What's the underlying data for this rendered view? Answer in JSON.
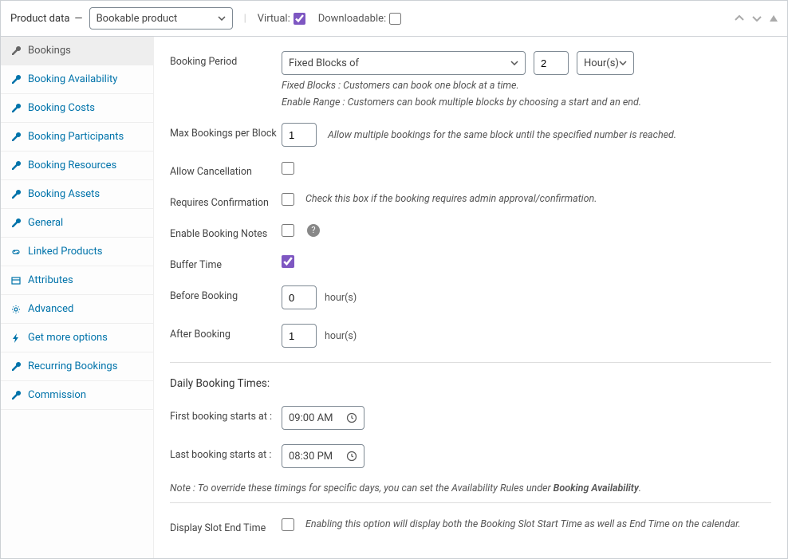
{
  "header": {
    "title": "Product data",
    "product_type": "Bookable product",
    "virtual_label": "Virtual:",
    "virtual_checked": true,
    "downloadable_label": "Downloadable:",
    "downloadable_checked": false
  },
  "sidebar": {
    "items": [
      {
        "label": "Bookings",
        "icon": "wrench",
        "active": true
      },
      {
        "label": "Booking Availability",
        "icon": "wrench",
        "active": false
      },
      {
        "label": "Booking Costs",
        "icon": "wrench",
        "active": false
      },
      {
        "label": "Booking Participants",
        "icon": "wrench",
        "active": false
      },
      {
        "label": "Booking Resources",
        "icon": "wrench",
        "active": false
      },
      {
        "label": "Booking Assets",
        "icon": "wrench",
        "active": false
      },
      {
        "label": "General",
        "icon": "wrench",
        "active": false
      },
      {
        "label": "Linked Products",
        "icon": "link",
        "active": false
      },
      {
        "label": "Attributes",
        "icon": "box",
        "active": false
      },
      {
        "label": "Advanced",
        "icon": "gear",
        "active": false
      },
      {
        "label": "Get more options",
        "icon": "bolt",
        "active": false
      },
      {
        "label": "Recurring Bookings",
        "icon": "wrench",
        "active": false
      },
      {
        "label": "Commission",
        "icon": "wrench",
        "active": false
      }
    ]
  },
  "form": {
    "booking_period": {
      "label": "Booking Period",
      "type_value": "Fixed Blocks of",
      "qty": "2",
      "unit": "Hour(s)",
      "help1": "Fixed Blocks : Customers can book one block at a time.",
      "help2": "Enable Range : Customers can book multiple blocks by choosing a start and an end."
    },
    "max_bookings": {
      "label": "Max Bookings per Block",
      "value": "1",
      "help": "Allow multiple bookings for the same block until the specified number is reached."
    },
    "allow_cancellation": {
      "label": "Allow Cancellation",
      "checked": false
    },
    "requires_confirmation": {
      "label": "Requires Confirmation",
      "checked": false,
      "help": "Check this box if the booking requires admin approval/confirmation."
    },
    "enable_notes": {
      "label": "Enable Booking Notes",
      "checked": false
    },
    "buffer_time": {
      "label": "Buffer Time",
      "checked": true
    },
    "before_booking": {
      "label": "Before Booking",
      "value": "0",
      "unit": "hour(s)"
    },
    "after_booking": {
      "label": "After Booking",
      "value": "1",
      "unit": "hour(s)"
    },
    "daily_times": {
      "section_title": "Daily Booking Times:",
      "first_label": "First booking starts at :",
      "first_value": "09:00 AM",
      "last_label": "Last booking starts at :",
      "last_value": "08:30 PM",
      "note_prefix": "Note : To override these timings for specific days, you can set the Availability Rules under ",
      "note_strong": "Booking Availability",
      "note_suffix": "."
    },
    "display_slot_end": {
      "label": "Display Slot End Time",
      "checked": false,
      "help": "Enabling this option will display both the Booking Slot Start Time as well as End Time on the calendar."
    }
  }
}
